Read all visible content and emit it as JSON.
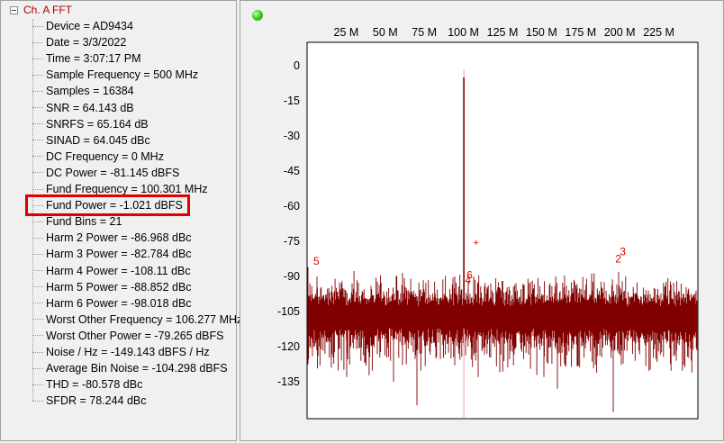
{
  "panel": {
    "root_label": "Ch. A FFT",
    "items": [
      "Device = AD9434",
      "Date = 3/3/2022",
      "Time = 3:07:17 PM",
      "Sample Frequency = 500 MHz",
      "Samples = 16384",
      "SNR = 64.143 dB",
      "SNRFS = 65.164 dB",
      "SINAD = 64.045 dBc",
      "DC Frequency = 0 MHz",
      "DC Power = -81.145 dBFS",
      "Fund Frequency = 100.301 MHz",
      "Fund Power = -1.021 dBFS",
      "Fund Bins = 21",
      "Harm 2 Power = -86.968 dBc",
      "Harm 3 Power = -82.784 dBc",
      "Harm 4 Power = -108.11 dBc",
      "Harm 5 Power = -88.852 dBc",
      "Harm 6 Power = -98.018 dBc",
      "Worst Other Frequency = 106.277 MHz",
      "Worst Other Power = -79.265 dBFS",
      "Noise / Hz = -149.143 dBFS / Hz",
      "Average Bin Noise = -104.298 dBFS",
      "THD = -80.578 dBc",
      "SFDR = 78.244 dBc"
    ],
    "highlighted_index": 11,
    "highlight_color": "#e00000"
  },
  "chart_data": {
    "type": "line",
    "x_ticks": [
      "25 M",
      "50 M",
      "75 M",
      "100 M",
      "125 M",
      "150 M",
      "175 M",
      "200 M",
      "225 M"
    ],
    "x_tick_values": [
      25,
      50,
      75,
      100,
      125,
      150,
      175,
      200,
      225
    ],
    "y_ticks": [
      "0",
      "-15",
      "-30",
      "-45",
      "-60",
      "-75",
      "-90",
      "-105",
      "-120",
      "-135"
    ],
    "y_tick_values": [
      0,
      -15,
      -30,
      -45,
      -60,
      -75,
      -90,
      -105,
      -120,
      -135
    ],
    "xlim": [
      0,
      250
    ],
    "ylim": [
      -150,
      10
    ],
    "series_color": "#800000",
    "noise_floor_dbfs": -108,
    "fundamental": {
      "freq_mhz": 100.301,
      "power_dbfs": -5
    },
    "markers": [
      {
        "label": "5",
        "freq_mhz": 4,
        "power_dbfs": -85
      },
      {
        "label": "3",
        "freq_mhz": 200,
        "power_dbfs": -81
      },
      {
        "label": "2",
        "freq_mhz": 200,
        "power_dbfs": -84
      },
      {
        "label": "4",
        "freq_mhz": 101,
        "power_dbfs": -93
      },
      {
        "label": "6",
        "freq_mhz": 102,
        "power_dbfs": -91
      },
      {
        "label": "+",
        "freq_mhz": 106.277,
        "power_dbfs": -77
      }
    ],
    "marker_color": "#e00000",
    "grid": false
  }
}
